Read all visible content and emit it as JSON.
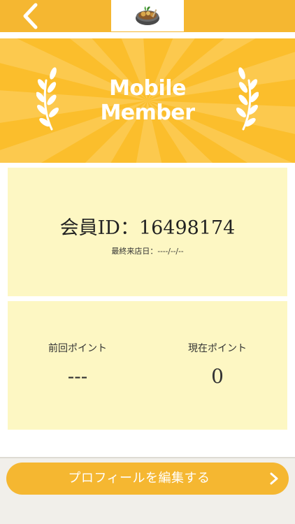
{
  "header": {
    "back_icon": "chevron-left-icon",
    "logo_icon": "food-bowl-icon"
  },
  "banner": {
    "title_line1": "Mobile",
    "title_line2": "Member",
    "decor_icon": "laurel-wreath-icon"
  },
  "member": {
    "id_text": "会員ID：16498174",
    "last_visit_text": "最終来店日：----/--/--"
  },
  "points": {
    "previous_label": "前回ポイント",
    "previous_value": "---",
    "current_label": "現在ポイント",
    "current_value": "0"
  },
  "action": {
    "edit_profile_label": "プロフィールを編集する",
    "arrow_icon": "chevron-right-icon"
  },
  "colors": {
    "accent": "#f5b731",
    "banner": "#fbbe2c",
    "card": "#fdf7c3",
    "background": "#f1efea"
  }
}
